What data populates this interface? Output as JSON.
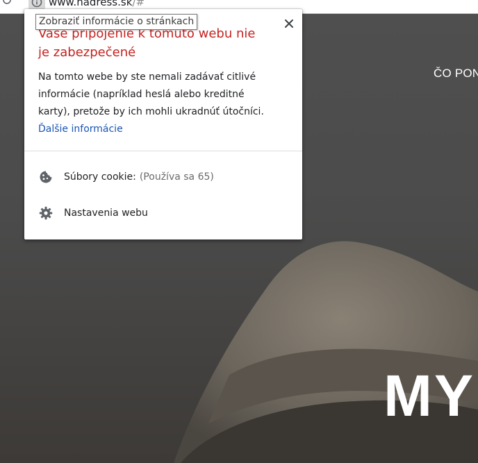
{
  "browser": {
    "url_host": "www.hadress.sk",
    "url_rest": "/#"
  },
  "tooltip": "Zobraziť informácie o stránkach",
  "popup": {
    "title": "Vaše pripojenie k tomuto webu nie je zabezpečené",
    "body": "Na tomto webe by ste nemali zadávať citlivé informácie (napríklad heslá alebo kreditné karty), pretože by ich mohli ukradnúť útočníci.",
    "learn_more": "Ďalšie informácie",
    "cookies_label": "Súbory cookie:",
    "cookies_count": "(Používa sa 65)",
    "site_settings": "Nastavenia webu"
  },
  "page": {
    "nav_link": "ČO PONÚKAME",
    "hero_title": "MY"
  },
  "colors": {
    "warning_red": "#c5221f",
    "link_blue": "#1a55b4"
  }
}
